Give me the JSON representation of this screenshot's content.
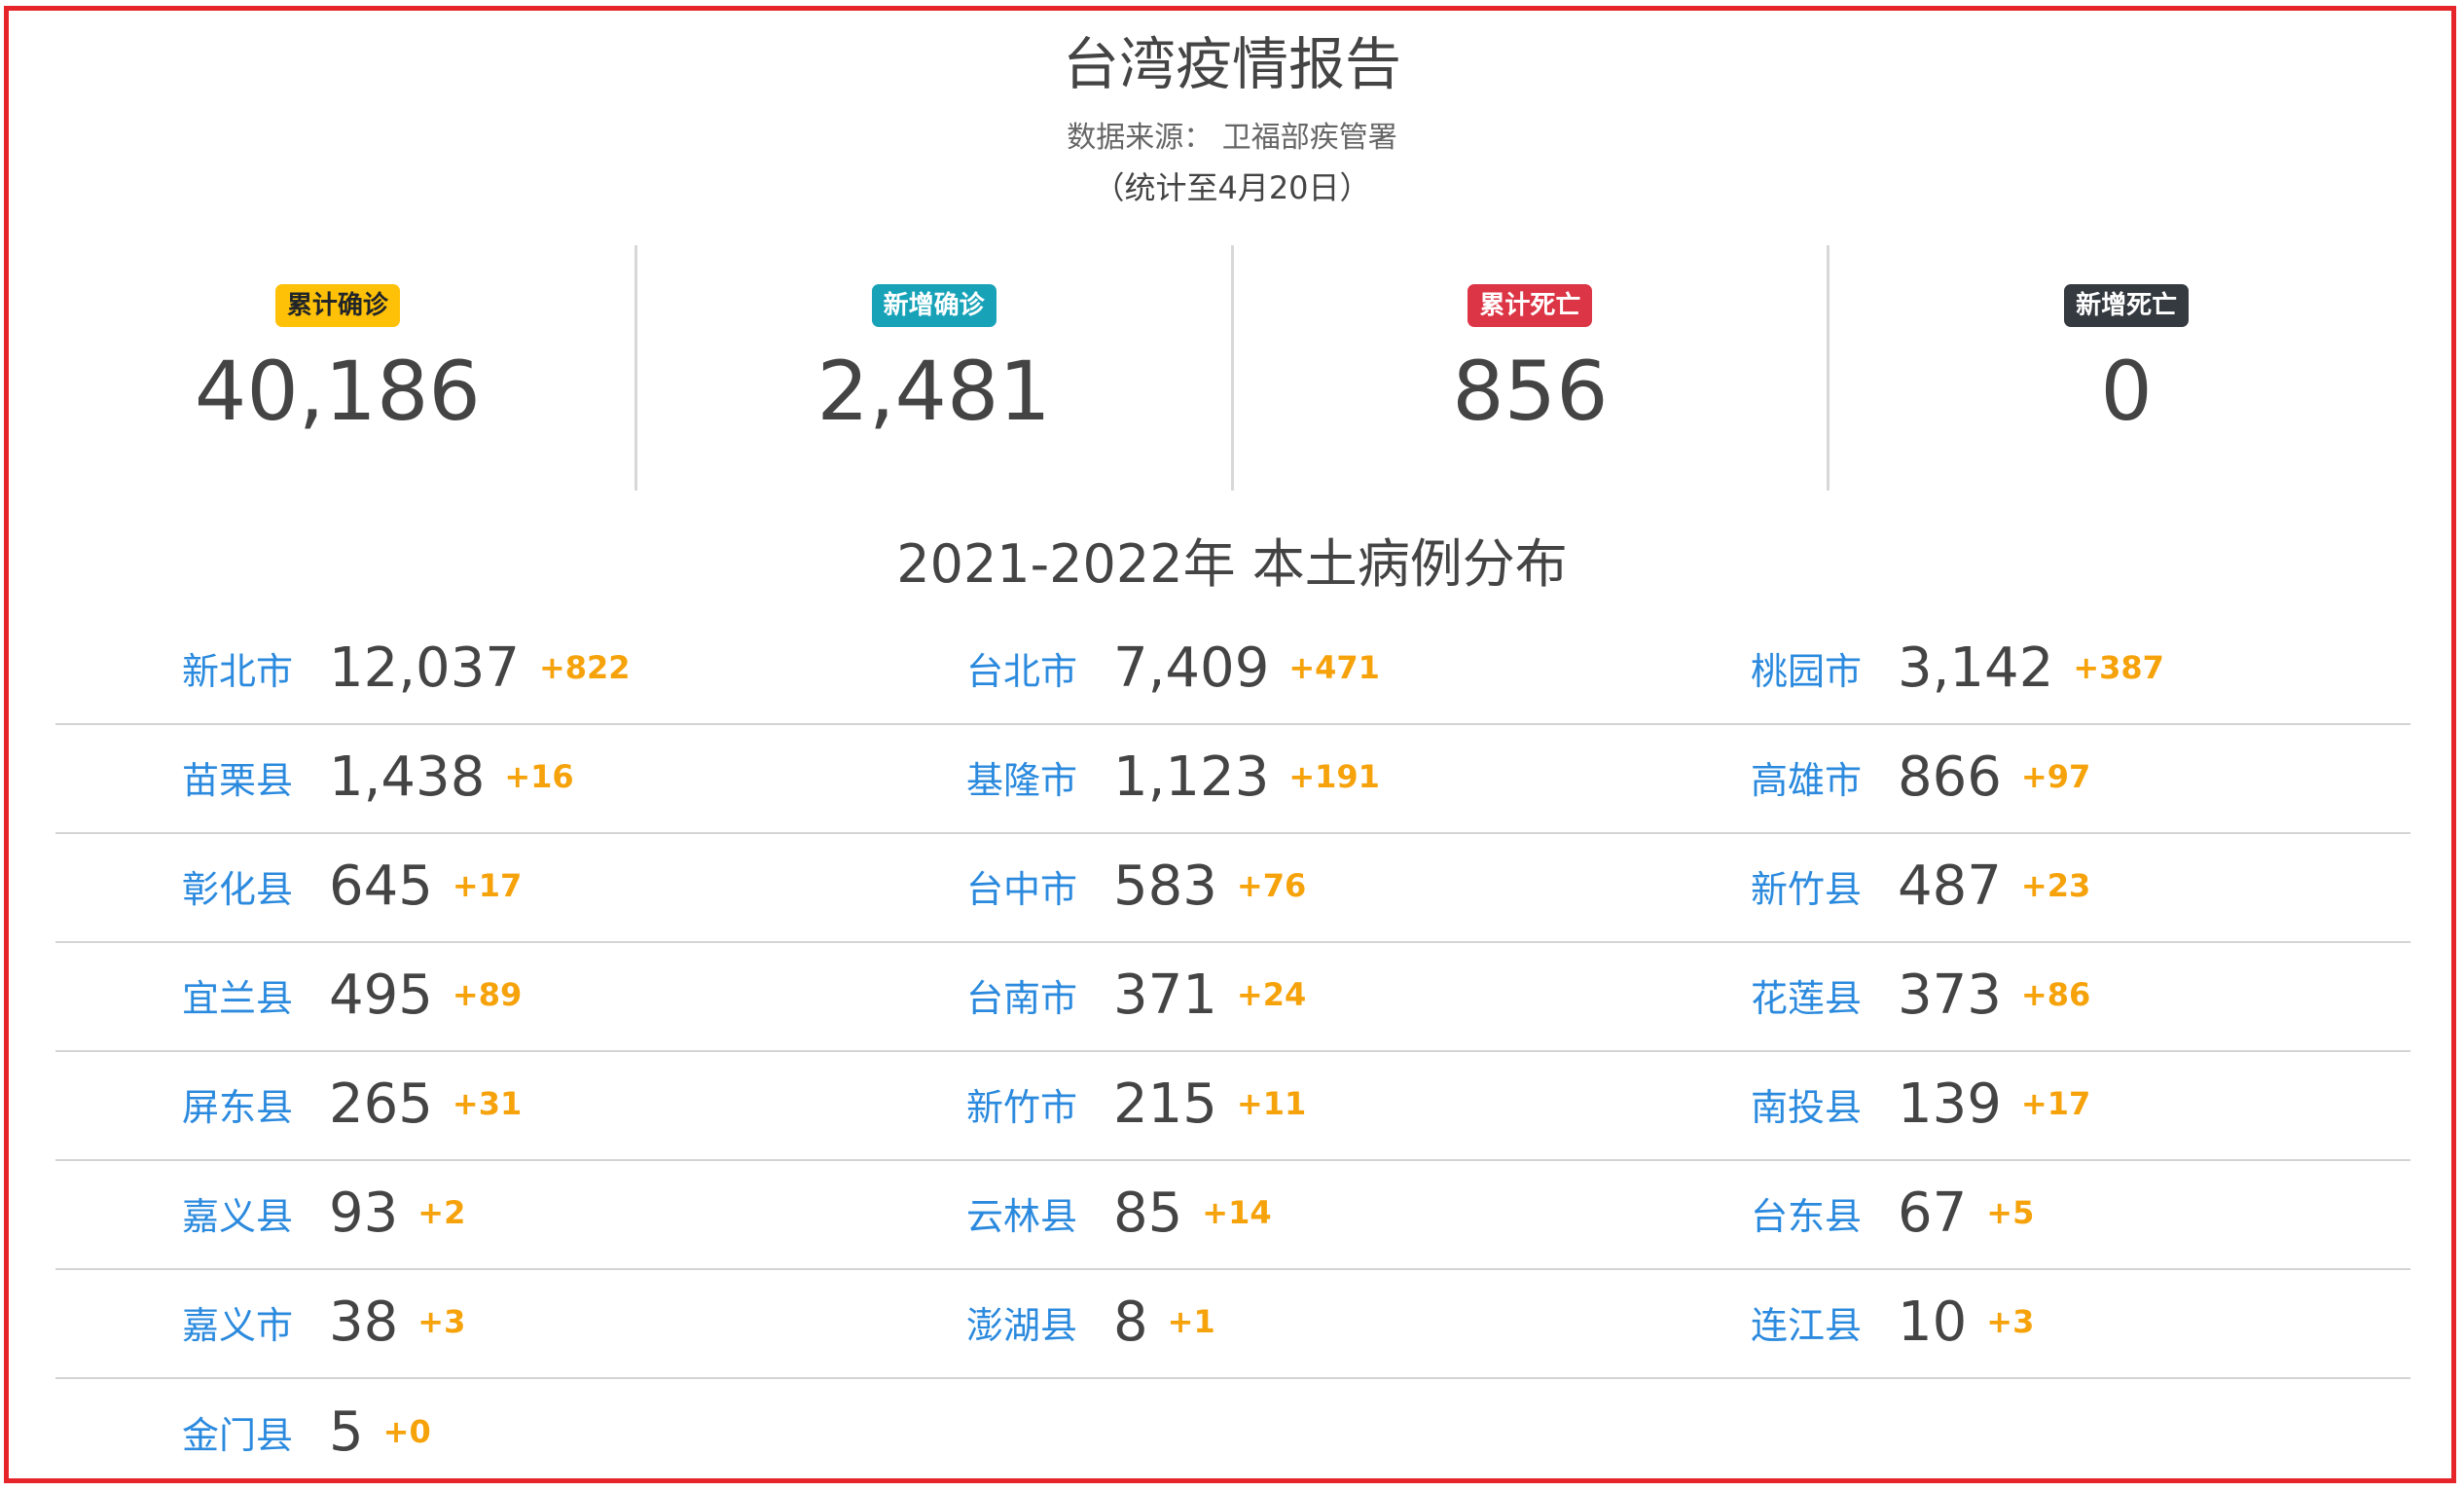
{
  "header": {
    "title": "台湾疫情报告",
    "source": "数据来源： 卫福部疾管署",
    "as_of": "（统计至4月20日）"
  },
  "stats": [
    {
      "label": "累计确诊",
      "value": "40,186",
      "badge_bg": "#ffc107",
      "badge_fg": "#212529"
    },
    {
      "label": "新增确诊",
      "value": "2,481",
      "badge_bg": "#17a2b8",
      "badge_fg": "#ffffff"
    },
    {
      "label": "累计死亡",
      "value": "856",
      "badge_bg": "#dc3545",
      "badge_fg": "#ffffff"
    },
    {
      "label": "新增死亡",
      "value": "0",
      "badge_bg": "#343a40",
      "badge_fg": "#ffffff"
    }
  ],
  "section": {
    "title": "2021-2022年 本土病例分布"
  },
  "colors": {
    "frame_border": "#e5252a",
    "region_name": "#2b8ade",
    "delta": "#f6a20b",
    "text": "#444444"
  },
  "regions": [
    {
      "name": "新北市",
      "count": "12,037",
      "delta": "+822"
    },
    {
      "name": "台北市",
      "count": "7,409",
      "delta": "+471"
    },
    {
      "name": "桃园市",
      "count": "3,142",
      "delta": "+387"
    },
    {
      "name": "苗栗县",
      "count": "1,438",
      "delta": "+16"
    },
    {
      "name": "基隆市",
      "count": "1,123",
      "delta": "+191"
    },
    {
      "name": "高雄市",
      "count": "866",
      "delta": "+97"
    },
    {
      "name": "彰化县",
      "count": "645",
      "delta": "+17"
    },
    {
      "name": "台中市",
      "count": "583",
      "delta": "+76"
    },
    {
      "name": "新竹县",
      "count": "487",
      "delta": "+23"
    },
    {
      "name": "宜兰县",
      "count": "495",
      "delta": "+89"
    },
    {
      "name": "台南市",
      "count": "371",
      "delta": "+24"
    },
    {
      "name": "花莲县",
      "count": "373",
      "delta": "+86"
    },
    {
      "name": "屏东县",
      "count": "265",
      "delta": "+31"
    },
    {
      "name": "新竹市",
      "count": "215",
      "delta": "+11"
    },
    {
      "name": "南投县",
      "count": "139",
      "delta": "+17"
    },
    {
      "name": "嘉义县",
      "count": "93",
      "delta": "+2"
    },
    {
      "name": "云林县",
      "count": "85",
      "delta": "+14"
    },
    {
      "name": "台东县",
      "count": "67",
      "delta": "+5"
    },
    {
      "name": "嘉义市",
      "count": "38",
      "delta": "+3"
    },
    {
      "name": "澎湖县",
      "count": "8",
      "delta": "+1"
    },
    {
      "name": "连江县",
      "count": "10",
      "delta": "+3"
    },
    {
      "name": "金门县",
      "count": "5",
      "delta": "+0"
    }
  ]
}
